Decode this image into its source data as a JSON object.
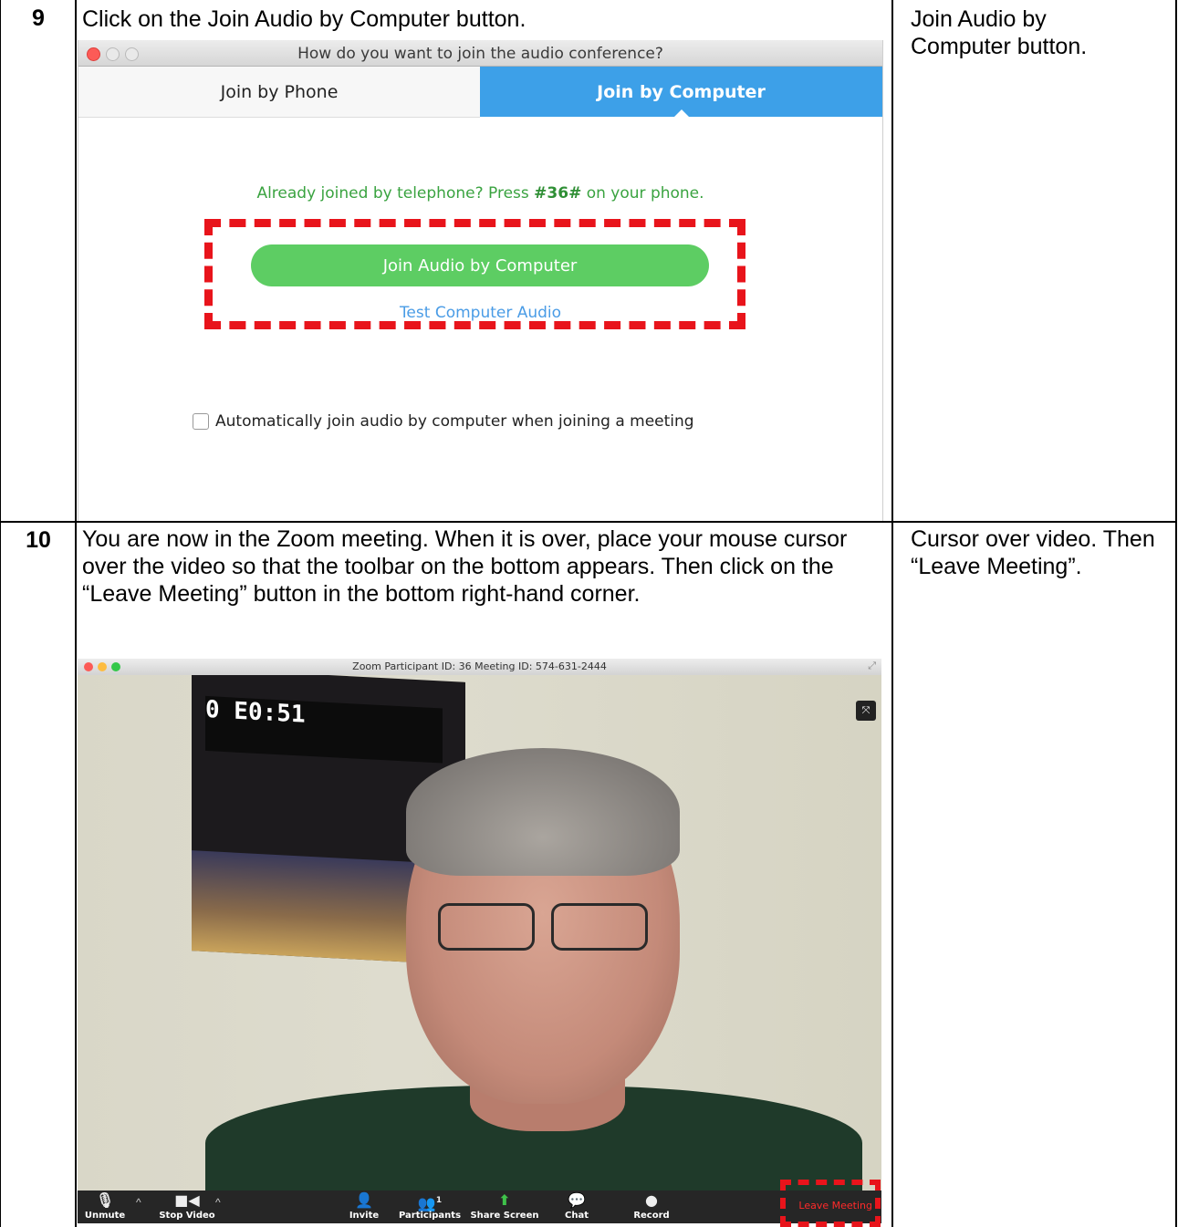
{
  "steps": [
    {
      "number": "9",
      "instruction": "Click on the Join Audio by Computer button.",
      "note": "Join Audio by Computer button."
    },
    {
      "number": "10",
      "instruction": "You are now in the Zoom meeting.  When it is over, place your mouse cursor over the video so that the toolbar on the bottom appears.  Then click on the “Leave Meeting” button in the bottom right-hand corner.",
      "note": "Cursor over video.  Then “Leave Meeting”."
    }
  ],
  "audio_dialog": {
    "title": "How do you want to join the audio conference?",
    "tabs": [
      {
        "label": "Join by Phone",
        "selected": false
      },
      {
        "label": "Join by Computer",
        "selected": true
      }
    ],
    "phone_hint_prefix": "Already joined by telephone? Press ",
    "phone_code": "#36#",
    "phone_hint_suffix": " on your phone.",
    "join_button": "Join Audio by Computer",
    "test_link": "Test Computer Audio",
    "auto_join_label": "Automatically join audio by computer when joining a meeting",
    "auto_join_checked": false
  },
  "meeting_window": {
    "title": "Zoom Participant ID: 36   Meeting ID: 574-631-2444",
    "scoreboard_text": "0    E0:51",
    "participant_count": "1",
    "toolbar": {
      "unmute": "Unmute",
      "stop_video": "Stop Video",
      "invite": "Invite",
      "participants": "Participants",
      "share_screen": "Share Screen",
      "chat": "Chat",
      "record": "Record",
      "leave": "Leave Meeting"
    }
  },
  "colors": {
    "accent_blue": "#3da0e8",
    "join_green": "#5dcd63",
    "highlight_red": "#e8141b",
    "leave_red": "#ff2a2a"
  }
}
